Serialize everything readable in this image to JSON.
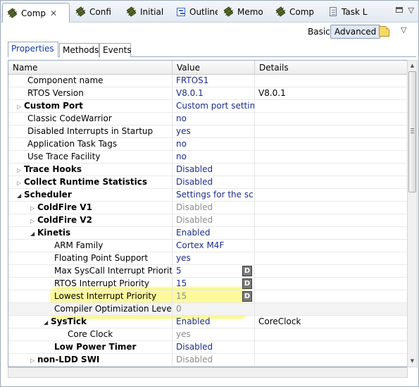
{
  "view_tabs": [
    {
      "label": "Comp",
      "icon": "component-chip-icon",
      "active": true,
      "closable": true
    },
    {
      "label": "Confi",
      "icon": "component-chip-icon"
    },
    {
      "label": "Initial",
      "icon": "component-chip-icon"
    },
    {
      "label": "Outline",
      "icon": "outline-icon"
    },
    {
      "label": "Memo",
      "icon": "component-chip-icon"
    },
    {
      "label": "Comp",
      "icon": "component-chip-icon"
    },
    {
      "label": "Task L",
      "icon": "task-list-icon"
    }
  ],
  "view_tabs_close": "✕",
  "view_menu": "▽",
  "toolbar": {
    "basic_label": "Basic",
    "advanced_label": "Advanced",
    "chevron": "▽"
  },
  "inner_tabs": [
    {
      "label": "Properties",
      "active": true
    },
    {
      "label": "Methods"
    },
    {
      "label": "Events"
    }
  ],
  "table": {
    "headers": {
      "name": "Name",
      "value": "Value",
      "details": "Details"
    },
    "rows": [
      {
        "name": "Component name",
        "value": "FRTOS1",
        "details": ""
      },
      {
        "name": "RTOS Version",
        "value": "V8.0.1",
        "details": "V8.0.1"
      },
      {
        "name": "Custom Port",
        "value": "Custom port settin...",
        "details": ""
      },
      {
        "name": "Classic CodeWarrior",
        "value": "no",
        "details": ""
      },
      {
        "name": "Disabled Interrupts in Startup",
        "value": "yes",
        "details": ""
      },
      {
        "name": "Application Task Tags",
        "value": "no",
        "details": ""
      },
      {
        "name": "Use Trace Facility",
        "value": "no",
        "details": ""
      },
      {
        "name": "Trace Hooks",
        "value": "Disabled",
        "details": ""
      },
      {
        "name": "Collect Runtime Statistics",
        "value": "Disabled",
        "details": ""
      },
      {
        "name": "Scheduler",
        "value": "Settings for the sc...",
        "details": ""
      },
      {
        "name": "ColdFire V1",
        "value": "Disabled",
        "details": ""
      },
      {
        "name": "ColdFire V2",
        "value": "Disabled",
        "details": ""
      },
      {
        "name": "Kinetis",
        "value": "Enabled",
        "details": ""
      },
      {
        "name": "ARM Family",
        "value": "Cortex M4F",
        "details": ""
      },
      {
        "name": "Floating Point Support",
        "value": "yes",
        "details": ""
      },
      {
        "name": "Max SysCall Interrupt Priority",
        "value": "5",
        "details": "",
        "button": "D"
      },
      {
        "name": "RTOS Interrupt Priority",
        "value": "15",
        "details": "",
        "button": "D"
      },
      {
        "name": "Lowest Interrupt Priority",
        "value": "15",
        "details": "",
        "button": "D"
      },
      {
        "name": "Compiler Optimization Level",
        "value": "0",
        "details": ""
      },
      {
        "name": "SysTick",
        "value": "Enabled",
        "details": "CoreClock"
      },
      {
        "name": "Core Clock",
        "value": "yes",
        "details": ""
      },
      {
        "name": "Low Power Timer",
        "value": "Disabled",
        "details": ""
      },
      {
        "name": "non-LDD SWI",
        "value": "Disabled",
        "details": ""
      }
    ]
  },
  "highlight_color": "#fbf99a",
  "value_color": "#1d2c8a",
  "disabled_value_color": "#8c8c8c",
  "active_tab_color": "#0d39a8"
}
